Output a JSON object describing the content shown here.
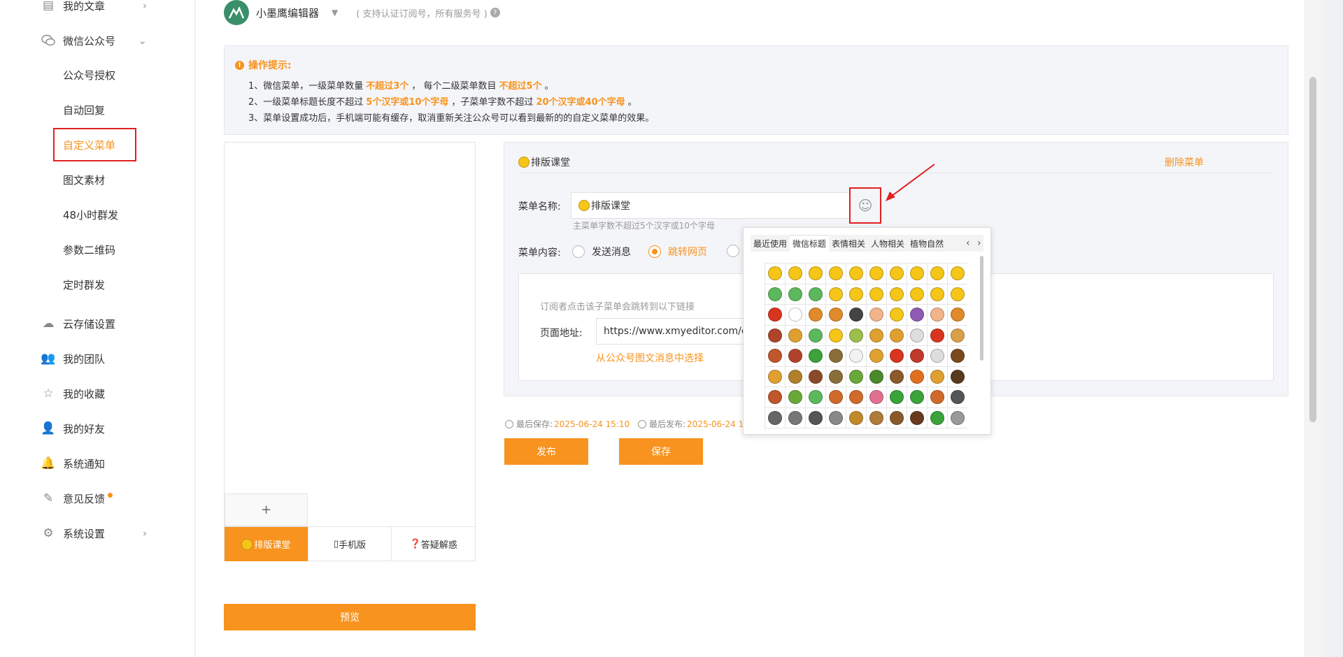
{
  "sidebar": {
    "items": [
      {
        "label": "我的文章",
        "icon": "document-icon",
        "chevron": "right"
      },
      {
        "label": "微信公众号",
        "icon": "wechat-icon",
        "chevron": "down"
      },
      {
        "label": "云存储设置",
        "icon": "cloud-icon"
      },
      {
        "label": "我的团队",
        "icon": "team-icon"
      },
      {
        "label": "我的收藏",
        "icon": "star-icon"
      },
      {
        "label": "我的好友",
        "icon": "add-friend-icon"
      },
      {
        "label": "系统通知",
        "icon": "bell-icon"
      },
      {
        "label": "意见反馈",
        "icon": "edit-icon"
      },
      {
        "label": "系统设置",
        "icon": "gear-icon",
        "chevron": "right"
      }
    ],
    "sub_items": [
      "公众号授权",
      "自动回复",
      "自定义菜单",
      "图文素材",
      "48小时群发",
      "参数二维码",
      "定时群发"
    ],
    "active_sub": "自定义菜单"
  },
  "account": {
    "name": "小墨鹰编辑器",
    "hint": "( 支持认证订阅号，所有服务号 )"
  },
  "tips": {
    "title": "操作提示:",
    "line1": {
      "a": "1、微信菜单，一级菜单数量",
      "b": "不超过3个",
      "c": "， 每个二级菜单数目",
      "d": "不超过5个",
      "e": "。"
    },
    "line2": {
      "a": "2、一级菜单标题长度不超过",
      "b": "5个汉字或10个字母",
      "c": "，子菜单字数不超过",
      "d": "20个汉字或40个字母",
      "e": "。"
    },
    "line3": "3、菜单设置成功后，手机端可能有缓存，取消重新关注公众号可以看到最新的的自定义菜单的效果。"
  },
  "phone": {
    "add_label": "+",
    "tabs": [
      {
        "label": "排版课堂",
        "emoji": true,
        "active": true
      },
      {
        "label": "手机版",
        "prefix": "▯"
      },
      {
        "label": "答疑解惑",
        "prefix": "❓"
      }
    ]
  },
  "editor": {
    "title": "排版课堂",
    "delete_label": "删除菜单",
    "name_label": "菜单名称:",
    "name_value": "排版课堂",
    "name_hint": "主菜单字数不超过5个汉字或10个字母",
    "content_label": "菜单内容:",
    "radio_send": "发送消息",
    "radio_link": "跳转网页",
    "link_hint": "订阅者点击该子菜单会跳转到以下链接",
    "url_label": "页面地址:",
    "url_value": "https://www.xmyeditor.com/educ",
    "pick_article": "从公众号图文消息中选择"
  },
  "meta": {
    "last_save_label": "最后保存:",
    "last_save_value": "2025-06-24 15:10",
    "last_publish_label": "最后发布:",
    "last_publish_value": "2025-06-24 1!"
  },
  "actions": {
    "publish": "发布",
    "save": "保存",
    "preview": "预览"
  },
  "emoji_picker": {
    "tabs": [
      "最近使用",
      "微信标题",
      "表情相关",
      "人物相关",
      "植物自然"
    ],
    "active_tab": "微信标题",
    "palette": [
      "#f5c518",
      "#f5c518",
      "#f5c518",
      "#f5c518",
      "#f5c518",
      "#f5c518",
      "#f5c518",
      "#f5c518",
      "#f5c518",
      "#f5c518",
      "#5cb85c",
      "#5cb85c",
      "#5cb85c",
      "#f5c518",
      "#f5c518",
      "#f5c518",
      "#f5c518",
      "#f5c518",
      "#f5c518",
      "#f5c518",
      "#d9341f",
      "#ffffff",
      "#e08a2b",
      "#e08a2b",
      "#444444",
      "#f2b48a",
      "#f5c518",
      "#8e5bb5",
      "#f2b48a",
      "#e08a2b",
      "#b0432b",
      "#e0a030",
      "#5cb85c",
      "#f5c518",
      "#9bbf4a",
      "#e0a030",
      "#e0a030",
      "#dddddd",
      "#d9341f",
      "#d9a04a",
      "#c0562b",
      "#b0432b",
      "#3aa33a",
      "#8a6e3a",
      "#f2f2f2",
      "#e0a030",
      "#d9341f",
      "#c0392b",
      "#dddddd",
      "#7a4a1e",
      "#e0a030",
      "#b0802a",
      "#8a4a2a",
      "#8a6e3a",
      "#6aa83a",
      "#4a8a2a",
      "#8a5a2a",
      "#e07020",
      "#e0a030",
      "#5a3a1e",
      "#c0562b",
      "#6aa83a",
      "#5cb85c",
      "#d06a2a",
      "#d06a2a",
      "#e07090",
      "#3aa33a",
      "#3aa33a",
      "#d06a2a",
      "#555555",
      "#666666",
      "#777777",
      "#555555",
      "#888888",
      "#c08a2a",
      "#b07a3a",
      "#8a5a2a",
      "#6a3a1e",
      "#3aa33a",
      "#999999"
    ]
  }
}
